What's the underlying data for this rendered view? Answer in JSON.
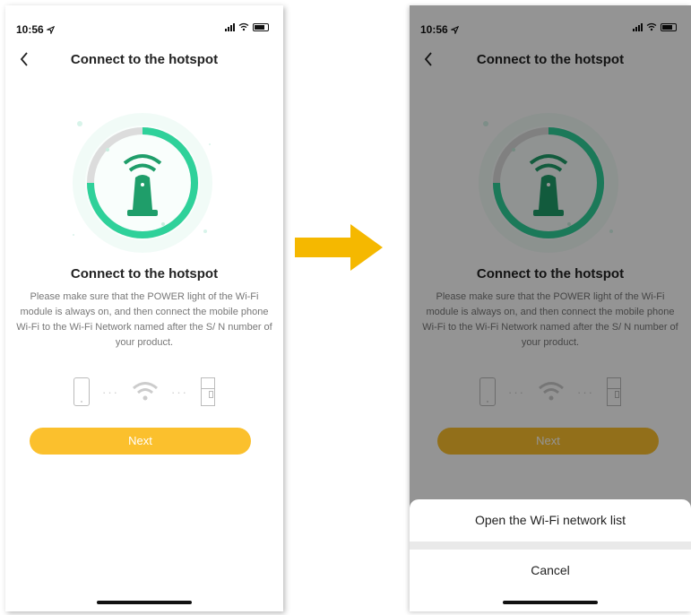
{
  "left_screen": {
    "status": {
      "time": "10:56"
    },
    "nav": {
      "title": "Connect to the hotspot"
    },
    "content": {
      "title": "Connect to the hotspot",
      "description": "Please make sure that the POWER light of the Wi-Fi module is always on, and then connect the mobile phone Wi-Fi to the Wi-Fi Network named after the S/ N number of your product."
    },
    "flow": {
      "dots": "···"
    },
    "next_label": "Next"
  },
  "right_screen": {
    "status": {
      "time": "10:56"
    },
    "nav": {
      "title": "Connect to the hotspot"
    },
    "content": {
      "title": "Connect to the hotspot",
      "description": "Please make sure that the POWER light of the Wi-Fi module is always on, and then connect the mobile phone Wi-Fi to the Wi-Fi Network named after the S/ N number of your product."
    },
    "flow": {
      "dots": "···"
    },
    "next_label": "Next",
    "action_sheet": {
      "option": "Open the Wi-Fi network list",
      "cancel": "Cancel"
    }
  },
  "colors": {
    "accent": "#fbc02d",
    "ring_green": "#29c98f",
    "ring_teal": "#5ee0c6",
    "icon_green": "#1f9e6a",
    "arrow": "#f5b800",
    "sheet_gap": "#e9e9e9"
  },
  "icons": [
    "location-arrow-icon",
    "signal-icon",
    "wifi-icon",
    "battery-icon",
    "back-chevron-icon",
    "hotspot-tower-icon",
    "phone-icon",
    "fridge-icon",
    "right-arrow-icon"
  ]
}
